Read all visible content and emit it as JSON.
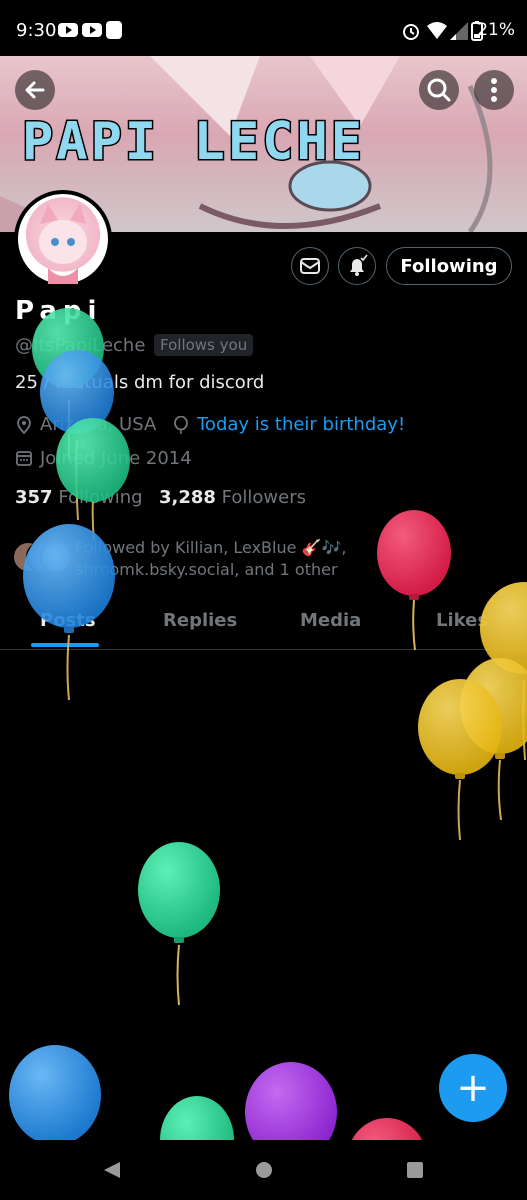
{
  "status_bar": {
    "time": "9:30",
    "battery": "21%"
  },
  "banner": {
    "title": "PAPI LECHE"
  },
  "profile": {
    "display_name": "Papi",
    "handle": "@ItsPapiLeche",
    "follows_you": "Follows you",
    "bio": "25 / mutuals dm for discord",
    "location": "Arizona, USA",
    "birthday": "Today is their birthday!",
    "joined": "Joined June 2014",
    "following_count": "357",
    "following_label": "Following",
    "followers_count": "3,288",
    "followers_label": "Followers",
    "followed_by_line1": "Followed by Killian, LexBlue 🎸🎶,",
    "followed_by_line2": "shroomk.bsky.social, and 1 other"
  },
  "actions": {
    "following_button": "Following"
  },
  "tabs": [
    {
      "label": "Posts"
    },
    {
      "label": "Replies"
    },
    {
      "label": "Media"
    },
    {
      "label": "Likes"
    }
  ],
  "fab": {
    "label": "+"
  },
  "colors": {
    "accent": "#1d9bf0",
    "background": "#000000",
    "muted_text": "#71767b",
    "balloon_green": "#1fd08f",
    "balloon_blue": "#1e88e5",
    "balloon_red": "#e0204d",
    "balloon_yellow": "#f2c21b",
    "balloon_purple": "#9b2ed8"
  }
}
